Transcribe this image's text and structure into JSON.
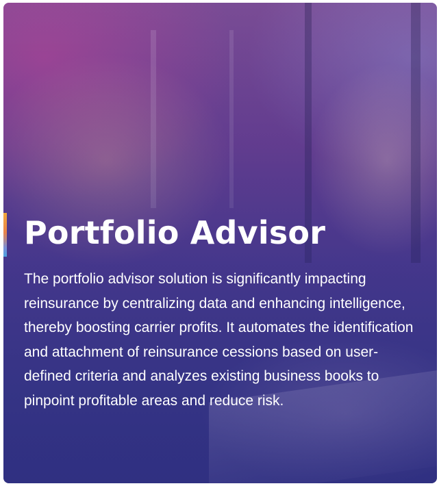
{
  "card": {
    "title": "Portfolio Advisor",
    "description": "The portfolio advisor solution is significantly impacting reinsurance by centralizing data and enhancing intelligence, thereby boosting carrier profits. It automates the identification and attachment of reinsurance cessions based on user-defined criteria and analyzes existing business books to pinpoint profitable areas and reduce risk.",
    "background_image": "business-meeting-photo",
    "accent_colors": [
      "#f2a93b",
      "#e8834a",
      "#4aa3e0"
    ],
    "overlay_colors": [
      "#7a4f93",
      "#4b3a8c",
      "#34357f"
    ]
  }
}
